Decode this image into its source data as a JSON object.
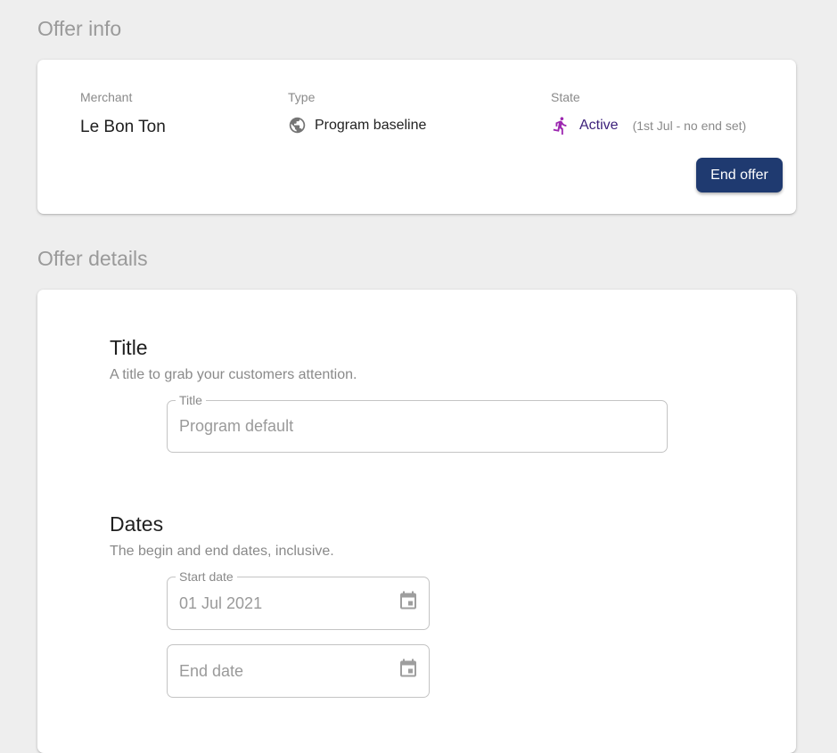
{
  "offer_info": {
    "heading": "Offer info",
    "merchant": {
      "label": "Merchant",
      "value": "Le Bon Ton"
    },
    "type": {
      "label": "Type",
      "value": "Program baseline",
      "icon": "globe-icon"
    },
    "state": {
      "label": "State",
      "value": "Active",
      "note": "(1st Jul - no end set)",
      "icon": "running-person-icon",
      "icon_color": "#9c27b0",
      "value_color": "#3b1f7a"
    },
    "end_offer_label": "End offer",
    "end_offer_color": "#1f3a70"
  },
  "offer_details": {
    "heading": "Offer details",
    "title_section": {
      "title": "Title",
      "description": "A title to grab your customers attention.",
      "field_label": "Title",
      "field_placeholder": "Program default"
    },
    "dates_section": {
      "title": "Dates",
      "description": "The begin and end dates, inclusive.",
      "start_label": "Start date",
      "start_value": "01 Jul 2021",
      "end_placeholder": "End date",
      "icon": "calendar-icon"
    }
  }
}
